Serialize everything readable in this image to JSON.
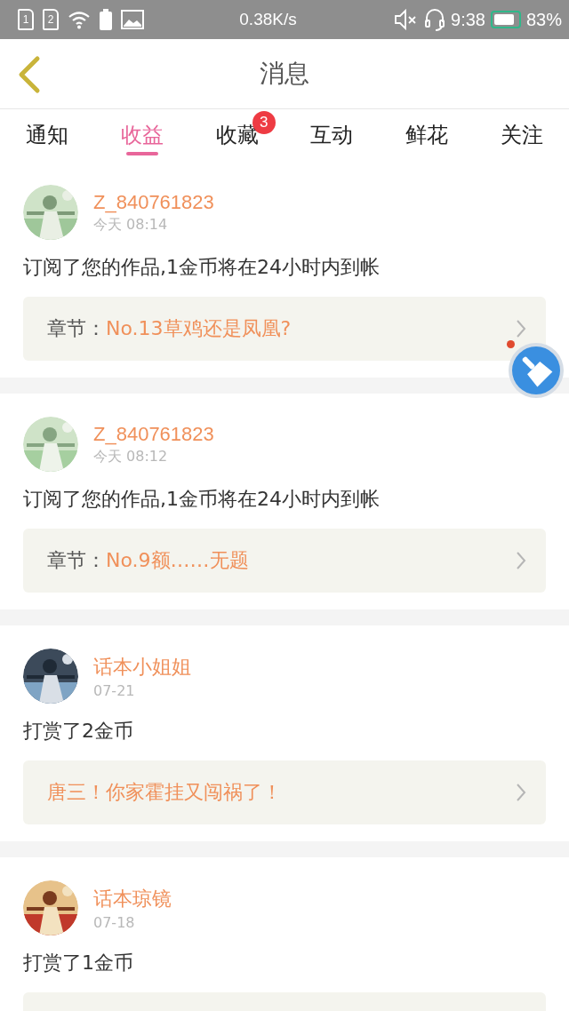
{
  "status_bar": {
    "sims": [
      "1",
      "2"
    ],
    "speed": "0.38K/s",
    "time": "9:38",
    "battery": "83%"
  },
  "header": {
    "title": "消息"
  },
  "tabs": [
    {
      "label": "通知",
      "selected": false
    },
    {
      "label": "收益",
      "selected": true
    },
    {
      "label": "收藏",
      "selected": false,
      "badge": "3"
    },
    {
      "label": "互动",
      "selected": false
    },
    {
      "label": "鲜花",
      "selected": false
    },
    {
      "label": "关注",
      "selected": false
    }
  ],
  "messages": [
    {
      "user": "Z_840761823",
      "time": "今天 08:14",
      "text": "订阅了您的作品,1金币将在24小时内到帐",
      "card_label": "章节：",
      "card_value": "No.13草鸡还是凤凰?"
    },
    {
      "user": "Z_840761823",
      "time": "今天 08:12",
      "text": "订阅了您的作品,1金币将在24小时内到帐",
      "card_label": "章节：",
      "card_value": "No.9额……无题"
    },
    {
      "user": "话本小姐姐",
      "time": "07-21",
      "text": "打赏了2金币",
      "card_value": "唐三！你家霍挂又闯祸了！"
    },
    {
      "user": "话本琼镜",
      "time": "07-18",
      "text": "打赏了1金币"
    }
  ]
}
